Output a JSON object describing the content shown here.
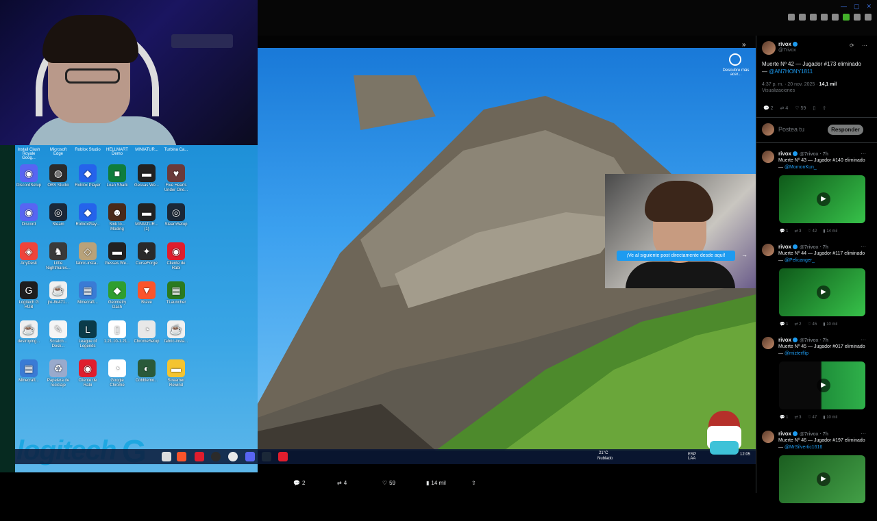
{
  "browser": {
    "win_controls": [
      "—",
      "▢",
      "✕"
    ]
  },
  "desktop": {
    "top_labels": [
      "Install Clash Royale Goog...",
      "Microsoft Edge",
      "Roblox Studio",
      "HELLMART Demo",
      "MINIATUR...",
      "Turbina Ca..."
    ],
    "icons": [
      {
        "label": "DiscordSetup",
        "color": "#5865f2",
        "glyph": "◉",
        "icon": "discord-icon"
      },
      {
        "label": "OBS Studio",
        "color": "#2b2b2b",
        "glyph": "◍",
        "icon": "obs-icon"
      },
      {
        "label": "Roblox Player",
        "color": "#2563eb",
        "glyph": "◆",
        "icon": "roblox-icon"
      },
      {
        "label": "Loan Shark",
        "color": "#0f7d3c",
        "glyph": "■",
        "icon": "game-icon"
      },
      {
        "label": "Gessas We...",
        "color": "#222",
        "glyph": "▬",
        "icon": "game-icon"
      },
      {
        "label": "Five Hearts Under One...",
        "color": "#6b3a3a",
        "glyph": "♥",
        "icon": "game-icon"
      },
      {
        "label": "Discord",
        "color": "#5865f2",
        "glyph": "◉",
        "icon": "discord-icon"
      },
      {
        "label": "Steam",
        "color": "#1b2838",
        "glyph": "◎",
        "icon": "steam-icon"
      },
      {
        "label": "RobloxPlay...",
        "color": "#2563eb",
        "glyph": "◆",
        "icon": "roblox-icon"
      },
      {
        "label": "Sink to... Moding",
        "color": "#4a2a1a",
        "glyph": "☻",
        "icon": "game-icon"
      },
      {
        "label": "MINIATUR... (1)",
        "color": "#222",
        "glyph": "▬",
        "icon": "game-icon"
      },
      {
        "label": "SteamSetup",
        "color": "#1b2838",
        "glyph": "◎",
        "icon": "steam-icon"
      },
      {
        "label": "AnyDesk",
        "color": "#ef443b",
        "glyph": "◈",
        "icon": "anydesk-icon"
      },
      {
        "label": "Little Nightmares...",
        "color": "#3a3a3a",
        "glyph": "♞",
        "icon": "game-icon"
      },
      {
        "label": "fabric-insta...",
        "color": "#b8a27a",
        "glyph": "◇",
        "icon": "fabric-icon"
      },
      {
        "label": "Gessas We...",
        "color": "#222",
        "glyph": "▬",
        "icon": "game-icon"
      },
      {
        "label": "CurseForge",
        "color": "#2a2a2a",
        "glyph": "✦",
        "icon": "curseforge-icon"
      },
      {
        "label": "Cliente de Rabi",
        "color": "#e01d2d",
        "glyph": "◉",
        "icon": "app-icon"
      },
      {
        "label": "Logitech G HUB",
        "color": "#1e1e1e",
        "glyph": "G",
        "icon": "logitech-icon"
      },
      {
        "label": "jre-8u471...",
        "color": "#f0f0f0",
        "glyph": "☕",
        "icon": "java-icon"
      },
      {
        "label": "Minecraft...",
        "color": "#3a7bd5",
        "glyph": "▦",
        "icon": "minecraft-icon"
      },
      {
        "label": "Geometry Dash",
        "color": "#2f9e2f",
        "glyph": "◆",
        "icon": "geometry-dash-icon"
      },
      {
        "label": "Brave",
        "color": "#fb542b",
        "glyph": "▼",
        "icon": "brave-icon"
      },
      {
        "label": "TLauncher",
        "color": "#2b7a1f",
        "glyph": "▦",
        "icon": "tlauncher-icon"
      },
      {
        "label": "destroying...",
        "color": "#f0f0f0",
        "glyph": "☕",
        "icon": "java-icon"
      },
      {
        "label": "Scratch... Desk...",
        "color": "#f5f5f5",
        "glyph": "✎",
        "icon": "app-icon"
      },
      {
        "label": "League of Legends",
        "color": "#0a3b4a",
        "glyph": "L",
        "icon": "league-icon"
      },
      {
        "label": "1.21.10-1.21...",
        "color": "#ffffff",
        "glyph": "▯",
        "icon": "file-icon"
      },
      {
        "label": "ChromeSetup",
        "color": "#e8e8e8",
        "glyph": "◔",
        "icon": "chrome-icon"
      },
      {
        "label": "fabric-insta...",
        "color": "#f0f0f0",
        "glyph": "☕",
        "icon": "java-icon"
      },
      {
        "label": "Minecraft...",
        "color": "#3a7bd5",
        "glyph": "▦",
        "icon": "minecraft-icon"
      },
      {
        "label": "Papelera de reciclaje",
        "color": "#9ac",
        "glyph": "♻",
        "icon": "recycle-bin-icon"
      },
      {
        "label": "Cliente de Rabi",
        "color": "#e01d2d",
        "glyph": "◉",
        "icon": "app-icon"
      },
      {
        "label": "Google Chrome",
        "color": "#ffffff",
        "glyph": "◔",
        "icon": "chrome-icon"
      },
      {
        "label": "Cobblemo...",
        "color": "#2a5a3a",
        "glyph": "◐",
        "icon": "game-icon"
      },
      {
        "label": "Streamer Rewind",
        "color": "#f4c430",
        "glyph": "▬",
        "icon": "folder-icon"
      }
    ],
    "brand": "logitech",
    "brand_g": "G"
  },
  "pip": {
    "cta": "¡Ve al siguiente post directamente desde aquí!",
    "descubre": "Descubre más acer..."
  },
  "taskbar": {
    "weather_temp": "21°C",
    "weather_desc": "Nublado",
    "lang": "ESP LAA",
    "clock": "12:05"
  },
  "post_actions": [
    {
      "icon": "reply-icon",
      "glyph": "💬",
      "value": "2"
    },
    {
      "icon": "repost-icon",
      "glyph": "⇄",
      "value": "4"
    },
    {
      "icon": "like-icon",
      "glyph": "♡",
      "value": "59"
    },
    {
      "icon": "views-icon",
      "glyph": "▮",
      "value": "14 mil"
    },
    {
      "icon": "share-icon",
      "glyph": "⇧",
      "value": ""
    }
  ],
  "main_post": {
    "name": "rivox",
    "handle": "@7rivox",
    "text": "Muerte Nº 42 — Jugador #173 eliminado — ",
    "mention": "@AN7HONY1811",
    "meta": "4:37 p. m. · 20 nov. 2025 · ",
    "views_count": "14,1 mil",
    "views_label": "Visualizaciones",
    "stats": [
      "2",
      "4",
      "59"
    ],
    "reply_placeholder": "Postea tu",
    "reply_button": "Responder"
  },
  "replies": [
    {
      "name": "rivox",
      "handle": "@7rivox · 7h",
      "text": "Muerte Nº 43 — Jugador #140 eliminado — ",
      "mention": "@MomonKun_",
      "stats": [
        "1",
        "3",
        "42",
        "14 mil"
      ]
    },
    {
      "name": "rivox",
      "handle": "@7rivox · 7h",
      "text": "Muerte Nº 44 — Jugador #117 eliminado — ",
      "mention": "@Pelicanger_",
      "stats": [
        "1",
        "2",
        "45",
        "10 mil"
      ]
    },
    {
      "name": "rivox",
      "handle": "@7rivox · 7h",
      "text": "Muerte Nº 45 — Jugador #017 eliminado — ",
      "mention": "@mizterflip",
      "stats": [
        "1",
        "3",
        "47",
        "10 mil"
      ]
    },
    {
      "name": "rivox",
      "handle": "@7rivox · 7h",
      "text": "Muerte Nº 46 — Jugador #197 eliminado — ",
      "mention": "@MrSilvertic1616",
      "stats": []
    }
  ]
}
